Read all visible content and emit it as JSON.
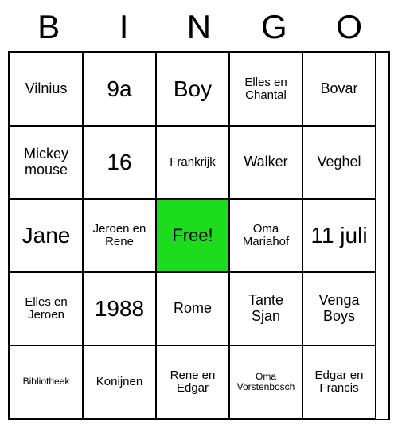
{
  "header": [
    "B",
    "I",
    "N",
    "G",
    "O"
  ],
  "grid": [
    [
      {
        "text": "Vilnius",
        "size": "normal"
      },
      {
        "text": "9a",
        "size": "big"
      },
      {
        "text": "Boy",
        "size": "big"
      },
      {
        "text": "Elles en Chantal",
        "size": "medium"
      },
      {
        "text": "Bovar",
        "size": "normal"
      }
    ],
    [
      {
        "text": "Mickey mouse",
        "size": "normal"
      },
      {
        "text": "16",
        "size": "big"
      },
      {
        "text": "Frankrijk",
        "size": "medium"
      },
      {
        "text": "Walker",
        "size": "normal"
      },
      {
        "text": "Veghel",
        "size": "normal"
      }
    ],
    [
      {
        "text": "Jane",
        "size": "big"
      },
      {
        "text": "Jeroen en Rene",
        "size": "medium"
      },
      {
        "text": "Free!",
        "size": "normal",
        "free": true
      },
      {
        "text": "Oma Mariahof",
        "size": "medium"
      },
      {
        "text": "11 juli",
        "size": "big"
      }
    ],
    [
      {
        "text": "Elles en Jeroen",
        "size": "medium"
      },
      {
        "text": "1988",
        "size": "big"
      },
      {
        "text": "Rome",
        "size": "normal"
      },
      {
        "text": "Tante Sjan",
        "size": "normal"
      },
      {
        "text": "Venga Boys",
        "size": "normal"
      }
    ],
    [
      {
        "text": "Bibliotheek",
        "size": "small"
      },
      {
        "text": "Konijnen",
        "size": "medium"
      },
      {
        "text": "Rene en Edgar",
        "size": "medium"
      },
      {
        "text": "Oma Vorstenbosch",
        "size": "small"
      },
      {
        "text": "Edgar en Francis",
        "size": "medium"
      }
    ]
  ]
}
